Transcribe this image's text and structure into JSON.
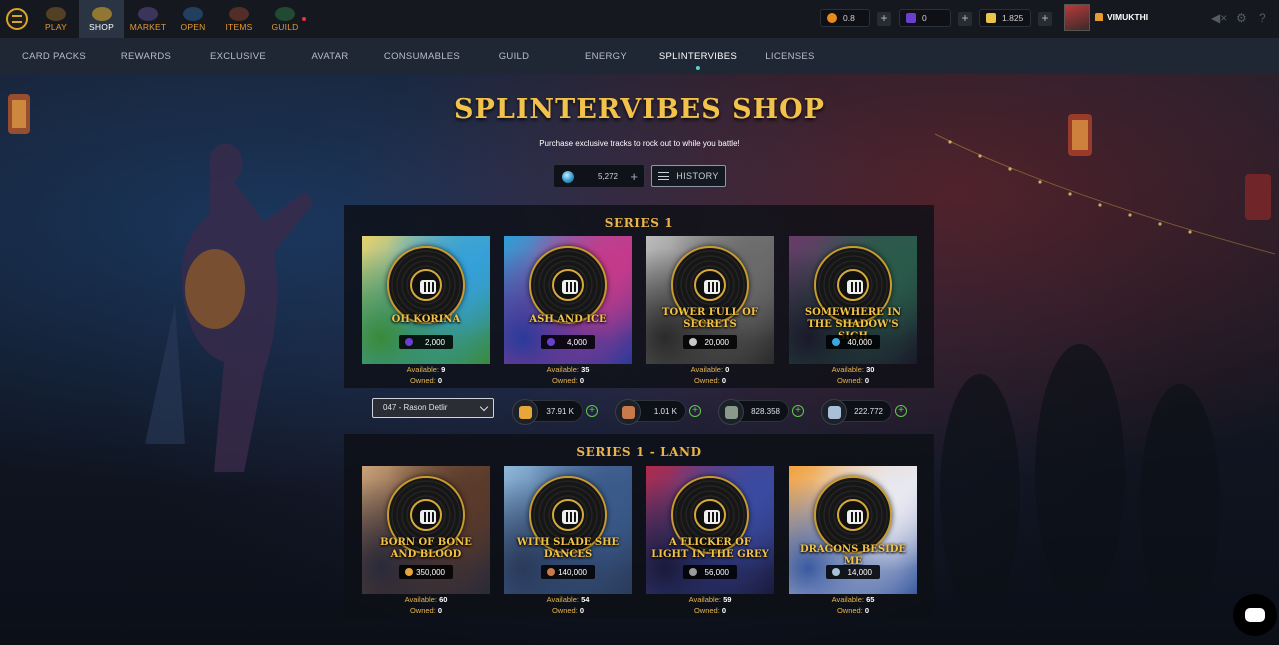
{
  "topnav": {
    "items": [
      {
        "label": "PLAY"
      },
      {
        "label": "SHOP",
        "active": true
      },
      {
        "label": "MARKET"
      },
      {
        "label": "OPEN"
      },
      {
        "label": "ITEMS"
      },
      {
        "label": "GUILD",
        "notification": true
      }
    ],
    "resources": [
      {
        "value": "0.8",
        "color": "#e88a1c"
      },
      {
        "value": "0",
        "color": "#6a3fcf"
      },
      {
        "value": "1.825",
        "color": "#e8c44a"
      }
    ],
    "username": "VIMUKTHI"
  },
  "subnav": {
    "items": [
      "CARD PACKS",
      "REWARDS",
      "EXCLUSIVE",
      "AVATAR",
      "CONSUMABLES",
      "GUILD",
      "ENERGY",
      "SPLINTERVIBES",
      "LICENSES"
    ],
    "active": "SPLINTERVIBES"
  },
  "shop": {
    "title": "SPLINTERVIBES SHOP",
    "subtitle": "Purchase exclusive tracks to rock out to while you battle!",
    "balance": "5,272",
    "history_label": "HISTORY"
  },
  "series": [
    {
      "title": "SERIES 1",
      "tracks": [
        {
          "name": "Oh Korina",
          "price": "2,000",
          "available": "9",
          "owned": "0",
          "price_icon_color": "#6a3fcf",
          "art": [
            "#e8d36a",
            "#35a0d8",
            "#3a8a3a"
          ]
        },
        {
          "name": "Ash and Ice",
          "price": "4,000",
          "available": "35",
          "owned": "0",
          "price_icon_color": "#6a3fcf",
          "art": [
            "#2aa0d8",
            "#c43a8a",
            "#2a3a9a"
          ]
        },
        {
          "name": "Tower Full of Secrets",
          "price": "20,000",
          "available": "0",
          "owned": "0",
          "price_icon_color": "#c8c8c8",
          "art": [
            "#bdbdbd",
            "#6a6a6a",
            "#2a2a2a"
          ]
        },
        {
          "name": "Somewhere in the Shadow's Sigh",
          "price": "40,000",
          "available": "30",
          "owned": "0",
          "price_icon_color": "#3aa8e0",
          "art": [
            "#6a3a6a",
            "#2a5a4a",
            "#1a1a2a"
          ]
        }
      ]
    },
    {
      "title": "SERIES 1 - LAND",
      "tracks": [
        {
          "name": "Born of Bone and Blood",
          "price": "350,000",
          "available": "60",
          "owned": "0",
          "price_icon_color": "#e8a53a",
          "art": [
            "#c9a27a",
            "#5a3a2a",
            "#2a2a3a"
          ]
        },
        {
          "name": "With Slade She Dances",
          "price": "140,000",
          "available": "54",
          "owned": "0",
          "price_icon_color": "#c87a4a",
          "art": [
            "#8fb8d8",
            "#3a5a8a",
            "#2a3a5a"
          ]
        },
        {
          "name": "A Flicker of Light in the Grey",
          "price": "56,000",
          "available": "59",
          "owned": "0",
          "price_icon_color": "#9a9a9a",
          "art": [
            "#b02a4a",
            "#3a4aa0",
            "#1a1a3a"
          ]
        },
        {
          "name": "Dragons Beside Me",
          "price": "14,000",
          "available": "65",
          "owned": "0",
          "price_icon_color": "#a8c0d8",
          "art": [
            "#f2a03a",
            "#e8e8f0",
            "#3a5aa0"
          ]
        }
      ]
    }
  ],
  "land": {
    "selected_plot": "047 - Rason Detlir",
    "resources": [
      {
        "value": "37.91 K",
        "color": "#e8a53a"
      },
      {
        "value": "1.01 K",
        "color": "#c87a4a"
      },
      {
        "value": "828.358",
        "color": "#8a9a8a"
      },
      {
        "value": "222.772",
        "color": "#a8c0d8"
      }
    ]
  },
  "labels": {
    "available": "Available:",
    "owned": "Owned:"
  }
}
